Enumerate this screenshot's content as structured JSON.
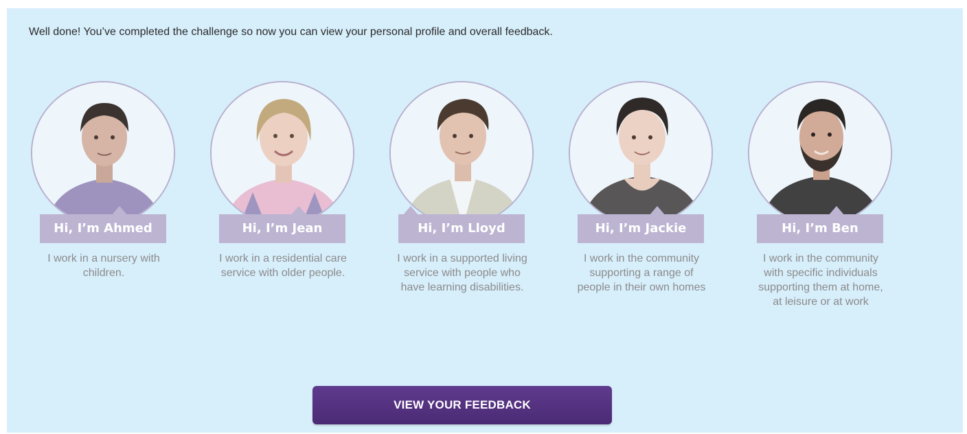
{
  "intro": "Well done! You’ve completed the challenge so now you can view your personal profile and overall feedback.",
  "people": [
    {
      "name": "Hi, I’m Ahmed",
      "description": "I work in a nursery with children.",
      "shirt_color": "#7b6aa6",
      "hair_color": "#3a3330"
    },
    {
      "name": "Hi, I’m Jean",
      "description": "I work in a residential care service with older people.",
      "shirt_color": "#e3a9c4",
      "hair_color": "#b69a6e"
    },
    {
      "name": "Hi, I’m Lloyd",
      "description": "I work in a supported living service with people who have learning disabilities.",
      "shirt_color": "#c9c9b8",
      "hair_color": "#4a3a30"
    },
    {
      "name": "Hi, I’m Jackie",
      "description": "I work in the community supporting a range of people in their own homes",
      "shirt_color": "#3e3a3a",
      "hair_color": "#2f2a28"
    },
    {
      "name": "Hi, I’m Ben",
      "description": "I work in the community with specific individuals supporting them at home, at leisure or at work",
      "shirt_color": "#2d2d2d",
      "hair_color": "#2a2624"
    }
  ],
  "cta": {
    "label": "VIEW YOUR FEEDBACK"
  },
  "colors": {
    "panel_bg": "#d7eefb",
    "name_tag_bg": "#bdb4d2",
    "cta_bg": "#553381"
  }
}
